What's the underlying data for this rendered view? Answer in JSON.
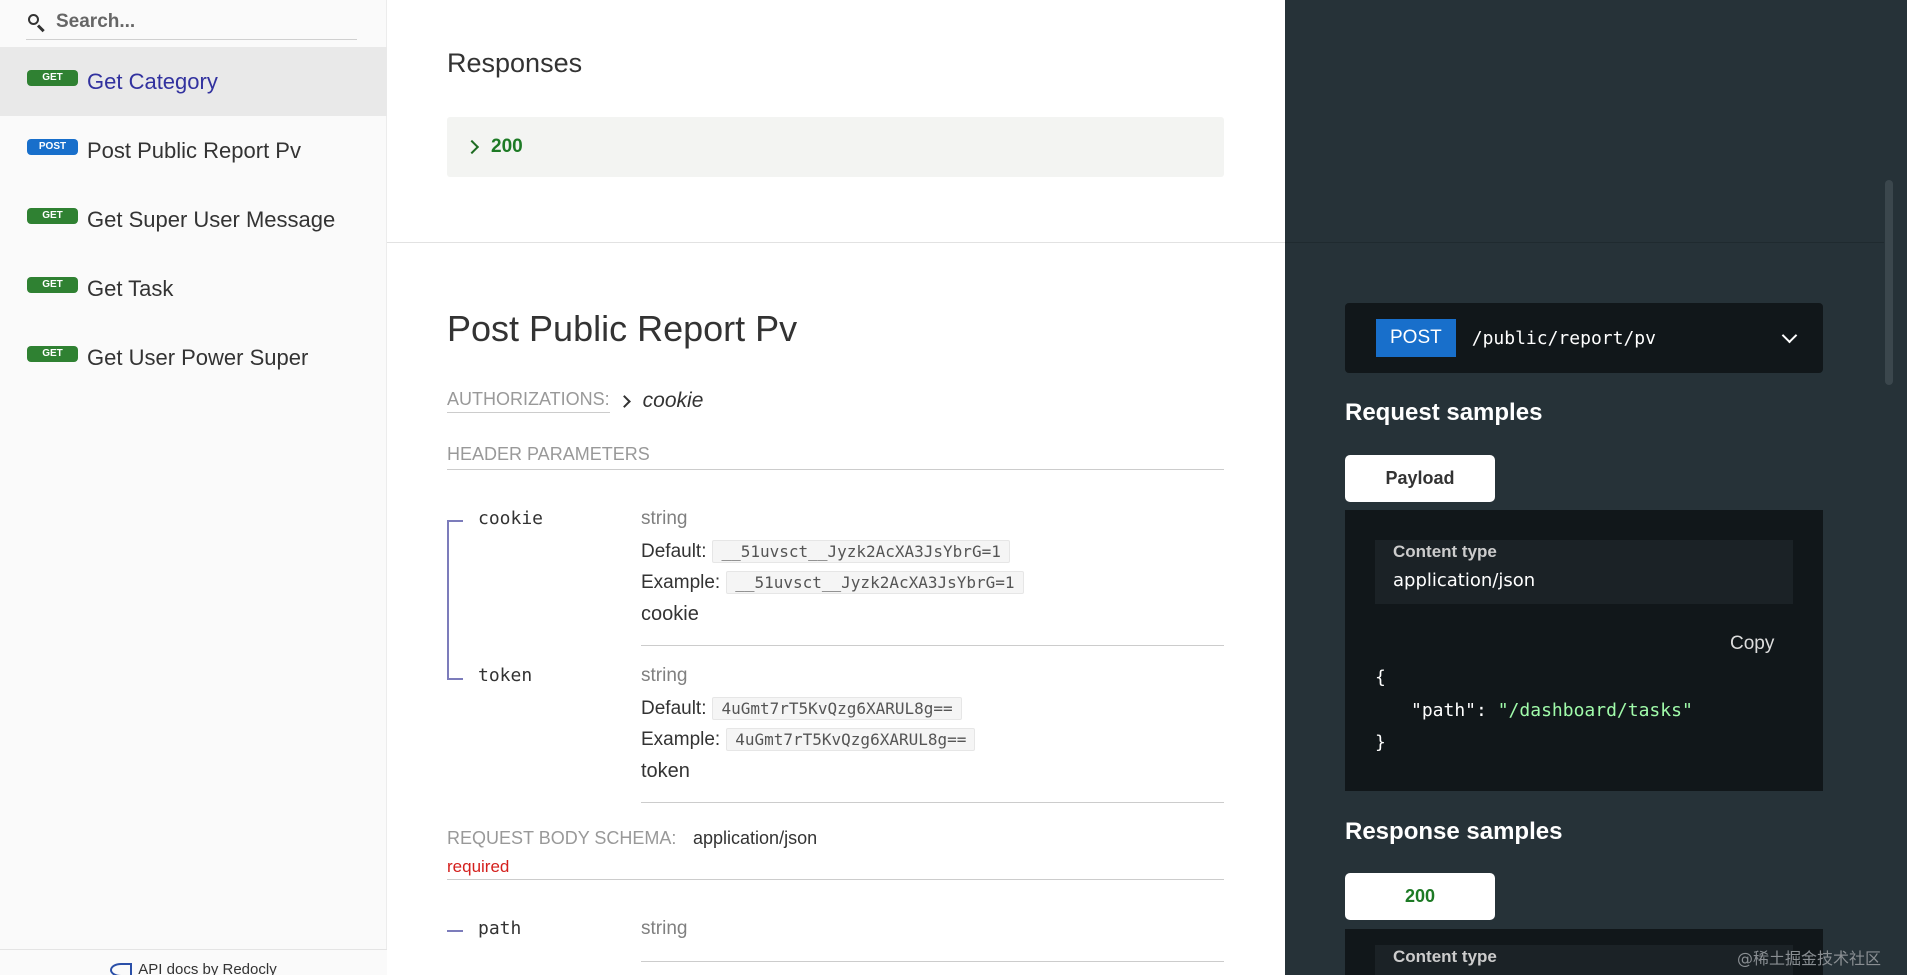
{
  "sidebar": {
    "search_placeholder": "Search...",
    "items": [
      {
        "method": "GET",
        "label": "Get Category",
        "active": true
      },
      {
        "method": "POST",
        "label": "Post Public Report Pv"
      },
      {
        "method": "GET",
        "label": "Get Super User Message"
      },
      {
        "method": "GET",
        "label": "Get Task"
      },
      {
        "method": "GET",
        "label": "Get User Power Super"
      }
    ],
    "footer": "API docs by Redocly"
  },
  "responses": {
    "title": "Responses",
    "code": "200"
  },
  "operation": {
    "title": "Post Public Report Pv",
    "auth_label": "AUTHORIZATIONS:",
    "auth_value": "cookie",
    "header_params_label": "HEADER PARAMETERS",
    "params": [
      {
        "name": "cookie",
        "type": "string",
        "default_label": "Default:",
        "default": "__51uvsct__Jyzk2AcXA3JsYbrG=1",
        "example_label": "Example:",
        "example": "__51uvsct__Jyzk2AcXA3JsYbrG=1",
        "description": "cookie"
      },
      {
        "name": "token",
        "type": "string",
        "default_label": "Default:",
        "default": "4uGmt7rT5KvQzg6XARUL8g==",
        "example_label": "Example:",
        "example": "4uGmt7rT5KvQzg6XARUL8g==",
        "description": "token"
      }
    ],
    "body_schema_label": "REQUEST BODY SCHEMA:",
    "body_schema_type": "application/json",
    "required_label": "required",
    "body_params": [
      {
        "name": "path",
        "type": "string"
      }
    ]
  },
  "right_panel": {
    "method": "POST",
    "path": "/public/report/pv",
    "request_samples_title": "Request samples",
    "request_tab": "Payload",
    "content_type_label": "Content type",
    "content_type_value": "application/json",
    "copy_label": "Copy",
    "code_open": "{",
    "code_key": "\"path\"",
    "code_colon": ": ",
    "code_value": "\"/dashboard/tasks\"",
    "code_close": "}",
    "response_samples_title": "Response samples",
    "response_tab": "200",
    "response_content_type_label": "Content type"
  },
  "watermark": "@稀土掘金技术社区",
  "colors": {
    "get_badge": "#2f8132",
    "post_badge": "#186fcb",
    "active_nav_text": "#32329f",
    "response_green": "#1d7a25",
    "right_panel_bg": "#263238",
    "code_bg": "#11171a",
    "json_string": "#a0fbaa",
    "required_red": "#d41f1c"
  }
}
